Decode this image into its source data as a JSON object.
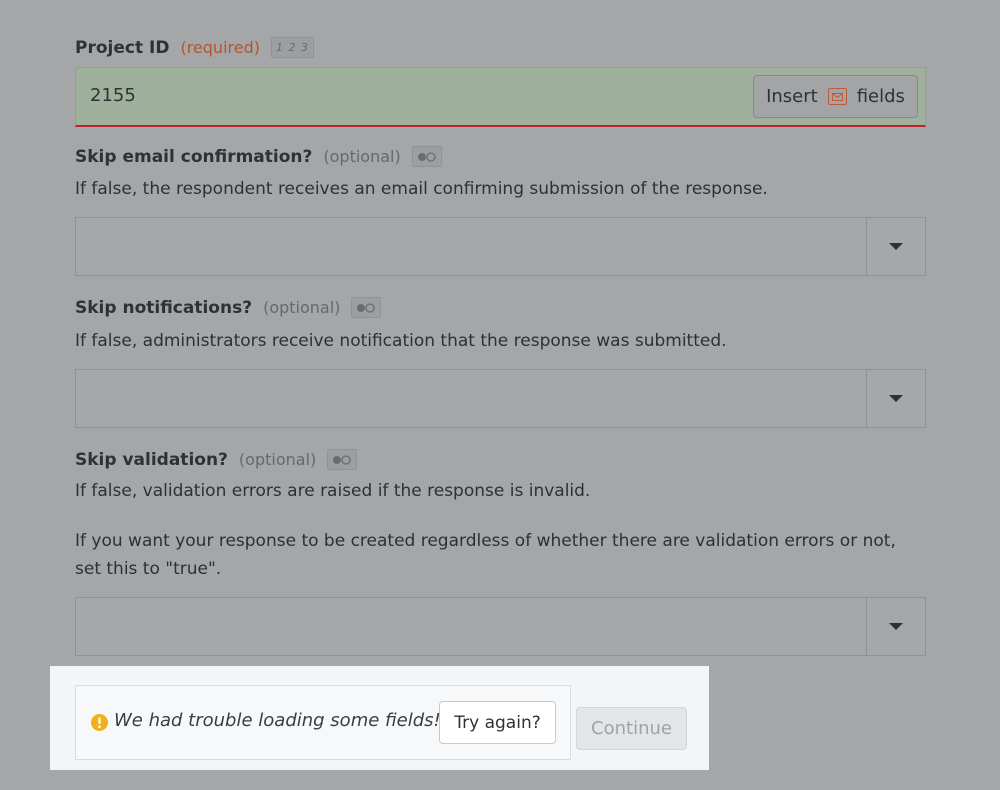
{
  "fields": {
    "project_id": {
      "label": "Project ID",
      "qualifier": "(required)",
      "type_badge": "1 2 3",
      "value": "2155",
      "insert_before": "Insert",
      "insert_after": "fields"
    },
    "skip_email": {
      "label": "Skip email confirmation?",
      "qualifier": "(optional)",
      "help": "If false, the respondent receives an email confirming submission of the response.",
      "value": ""
    },
    "skip_notifications": {
      "label": "Skip notifications?",
      "qualifier": "(optional)",
      "help": "If false, administrators receive notification that the response was submitted.",
      "value": ""
    },
    "skip_validation": {
      "label": "Skip validation?",
      "qualifier": "(optional)",
      "help": "If false, validation errors are raised if the response is invalid.",
      "help2_line1": "If you want your response to be created regardless of whether there are validation errors or not,",
      "help2_line2": "set this to \"true\".",
      "value": ""
    }
  },
  "alert": {
    "message": "We had trouble loading some fields!",
    "try_again": "Try again?"
  },
  "continue_label": "Continue",
  "colors": {
    "required": "#b5552e",
    "error_underline": "#c0212a",
    "input_valid_bg": "#9fb09c",
    "warning": "#f2b01e"
  },
  "icons": {
    "insert": "envelope-icon",
    "type": "number-type-icon",
    "boolean": "toggle-type-icon",
    "select": "caret-down-icon",
    "alert": "exclamation-circle-icon"
  }
}
